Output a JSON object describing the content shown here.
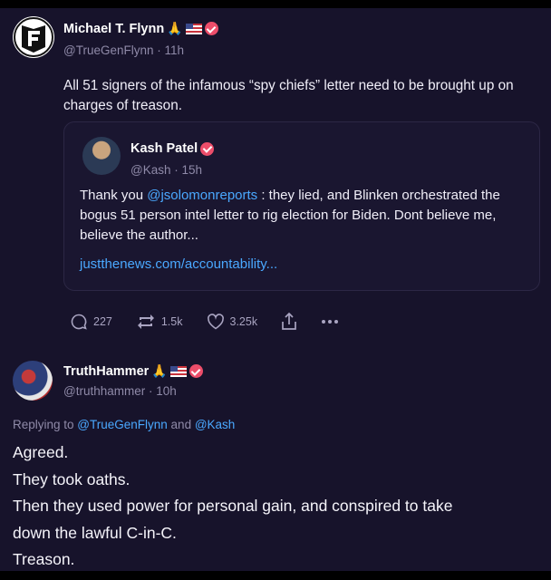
{
  "post1": {
    "author_name": "Michael T. Flynn",
    "handle_time": "@TrueGenFlynn · 11h",
    "body": "All 51 signers of the infamous “spy chiefs” letter need to be brought up on charges of treason.",
    "avatar_letter": "F"
  },
  "quote": {
    "author_name": "Kash Patel",
    "handle_time": "@Kash · 15h",
    "body_pre": "Thank you ",
    "mention": "@jsolomonreports",
    "body_post": " : they lied, and Blinken orchestrated the bogus 51 person intel letter to rig election for Biden. Dont believe me, believe the author...",
    "link": "justthenews.com/accountability..."
  },
  "actions": {
    "replies": "227",
    "retruths": "1.5k",
    "likes": "3.25k",
    "share_icon": "share-icon",
    "more_icon": "ellipsis-icon"
  },
  "post2": {
    "author_name": "TruthHammer",
    "handle_time": "@truthhammer · 10h",
    "replying_prefix": "Replying to ",
    "replying_to_1": "@TrueGenFlynn",
    "replying_and": " and ",
    "replying_to_2": "@Kash",
    "lines": [
      "Agreed.",
      "They took oaths.",
      "Then they used power for personal gain, and conspired to take",
      "down the lawful C-in-C.",
      "Treason."
    ]
  },
  "colors": {
    "background": "#17132b",
    "link": "#4aa8ff",
    "verified": "#ec4d6a",
    "muted": "#8f8aa8"
  }
}
